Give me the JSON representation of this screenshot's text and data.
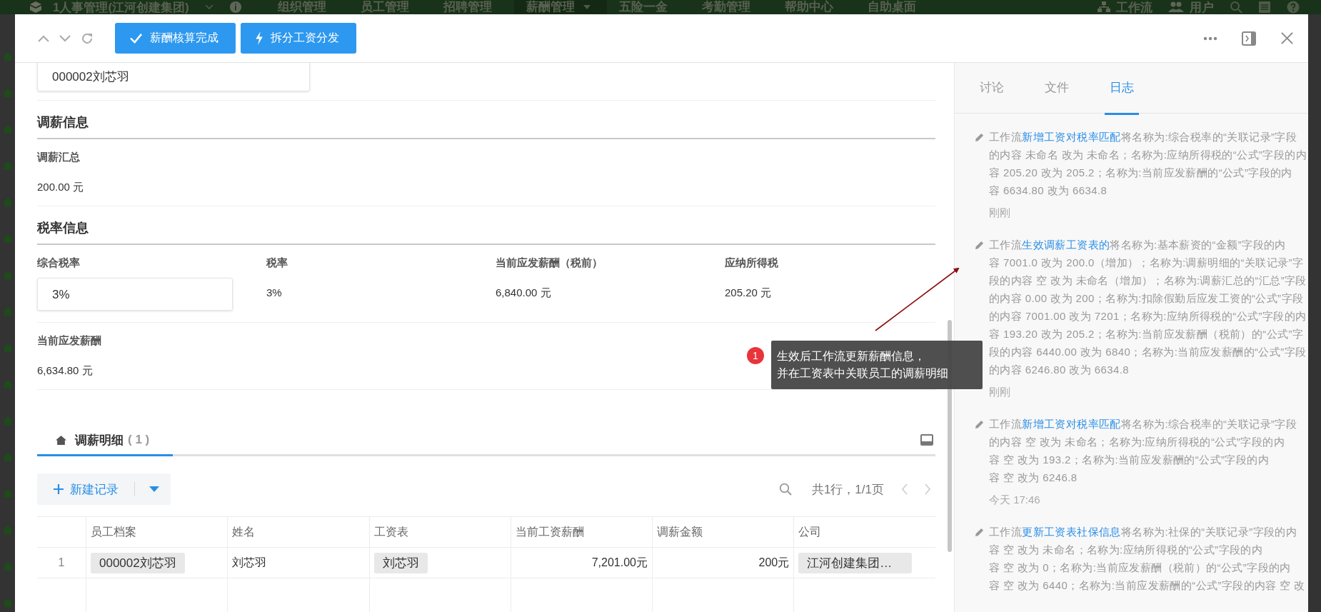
{
  "nav": {
    "app_title": "1人事管理(江河创建集团)",
    "items": [
      {
        "label": "组织管理",
        "selected": false,
        "has_menu": false
      },
      {
        "label": "员工管理",
        "selected": false,
        "has_menu": false
      },
      {
        "label": "招聘管理",
        "selected": false,
        "has_menu": false
      },
      {
        "label": "薪酬管理",
        "selected": true,
        "has_menu": true
      },
      {
        "label": "五险一金",
        "selected": false,
        "has_menu": false
      },
      {
        "label": "考勤管理",
        "selected": false,
        "has_menu": false
      },
      {
        "label": "帮助中心",
        "selected": false,
        "has_menu": false
      },
      {
        "label": "自助桌面",
        "selected": false,
        "has_menu": false
      }
    ],
    "right_items": [
      {
        "label": "工作流",
        "kind": "workflow"
      },
      {
        "label": "用户",
        "kind": "users"
      }
    ]
  },
  "toolbar": {
    "buttons": [
      {
        "label": "薪酬核算完成",
        "kind": "check"
      },
      {
        "label": "拆分工资分发",
        "kind": "bolt"
      }
    ]
  },
  "sections": [
    {
      "rows": [
        [
          {
            "kind": "input",
            "value": "000002刘芯羽"
          }
        ]
      ]
    },
    {
      "title": "调薪信息",
      "rows": [
        [
          {
            "kind": "text",
            "label": "调薪汇总",
            "value": "200.00 元"
          }
        ]
      ]
    },
    {
      "title": "税率信息",
      "rows": [
        [
          {
            "kind": "input",
            "label": "综合税率",
            "value": "3%"
          },
          {
            "kind": "text",
            "label": "税率",
            "value": "3%"
          },
          {
            "kind": "text",
            "label": "当前应发薪酬（税前）",
            "value": "6,840.00 元"
          },
          {
            "kind": "text",
            "label": "应纳所得税",
            "value": "205.20 元"
          }
        ],
        [
          {
            "kind": "text",
            "label": "当前应发薪酬",
            "value": "6,634.80 元"
          }
        ]
      ]
    }
  ],
  "subtable": {
    "tab": {
      "label": "调薪明细",
      "count": "( 1 )",
      "selected": true
    },
    "new_button": "新建记录",
    "pager": "共1行，1/1页",
    "columns": [
      "员工档案",
      "姓名",
      "工资表",
      "当前工资薪酬",
      "调薪金额",
      "公司"
    ],
    "rows": [
      {
        "index": "1",
        "cells": [
          {
            "kind": "tag",
            "value": "000002刘芯羽"
          },
          {
            "kind": "text",
            "value": "刘芯羽"
          },
          {
            "kind": "tag",
            "value": "刘芯羽"
          },
          {
            "kind": "number",
            "value": "7,201.00元"
          },
          {
            "kind": "number",
            "value": "200元"
          },
          {
            "kind": "tag",
            "value": "江河创建集团…"
          }
        ]
      }
    ]
  },
  "side_panel": {
    "tabs": [
      {
        "label": "讨论",
        "selected": false
      },
      {
        "label": "文件",
        "selected": false
      },
      {
        "label": "日志",
        "selected": true
      }
    ],
    "log": [
      {
        "before": "工作流",
        "link": "新增工资对税率匹配",
        "after": "将名称为:综合税率的“关联记录”字段的内容 未命名 改为 未命名；名称为:应纳所得税的“公式”字段的内容 205.20 改为 205.2；名称为:当前应发薪酬的“公式”字段的内容 6634.80 改为 6634.8",
        "time": "刚刚"
      },
      {
        "before": "工作流",
        "link": "生效调薪工资表的",
        "after": "将名称为:基本薪资的“金额”字段的内容 7001.0 改为 200.0（增加）；名称为:调薪明细的“关联记录”字段的内容 空 改为 未命名（增加）；名称为:调薪汇总的“汇总”字段的内容 0.00 改为 200；名称为:扣除假勤后应发工资的“公式”字段的内容 7001.00 改为 7201；名称为:应纳所得税的“公式”字段的内容 193.20 改为 205.2；名称为:当前应发薪酬（税前）的“公式”字段的内容 6440.00 改为 6840；名称为:当前应发薪酬的“公式”字段的内容 6246.80 改为 6634.8",
        "time": "刚刚"
      },
      {
        "before": "工作流",
        "link": "新增工资对税率匹配",
        "after": "将名称为:综合税率的“关联记录”字段的内容 空 改为 未命名；名称为:应纳所得税的“公式”字段的内容 空 改为 193.2；名称为:当前应发薪酬的“公式”字段的内容 空 改为 6246.8",
        "time": "今天 17:46"
      },
      {
        "before": "工作流",
        "link": "更新工资表社保信息",
        "after": "将名称为:社保的“关联记录”字段的内容 空 改为 未命名；名称为:应纳所得税的“公式”字段的内容 空 改为 0；名称为:当前应发薪酬（税前）的“公式”字段的内容 空 改为 6440；名称为:当前应发薪酬的“公式”字段的内容 空 改"
      }
    ]
  },
  "annotation": {
    "badge": "1",
    "lines": [
      "生效后工作流更新薪酬信息，",
      "并在工资表中关联员工的调薪明细"
    ]
  }
}
